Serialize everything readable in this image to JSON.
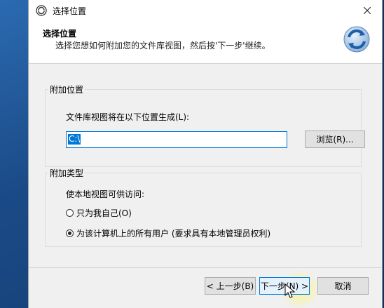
{
  "window": {
    "title": "选择位置"
  },
  "header": {
    "title": "选择位置",
    "subtitle": "选择您想如何附加您的文件库视图，然后按'下一步'继续。"
  },
  "location_group": {
    "title": "附加位置",
    "prompt": "文件库视图将在以下位置生成(L):",
    "path_value": "C:\\",
    "browse_label": "浏览(R)..."
  },
  "type_group": {
    "title": "附加类型",
    "prompt": "使本地视图可供访问:",
    "options": [
      {
        "label": "只为我自己(O)",
        "checked": false
      },
      {
        "label": "为该计算机上的所有用户 (要求具有本地管理员权利)",
        "checked": true
      }
    ]
  },
  "footer": {
    "back_label": "< 上一步(B)",
    "next_label": "下一步(N) >",
    "cancel_label": "取消"
  },
  "colors": {
    "accent": "#0078d7",
    "dialog_bg": "#f0f0f0",
    "desktop": "#1d4f87"
  },
  "icons": {
    "app": "app-logo-icon",
    "close": "close-icon",
    "header": "sync-arrows-icon",
    "cursor": "mouse-pointer-icon"
  }
}
